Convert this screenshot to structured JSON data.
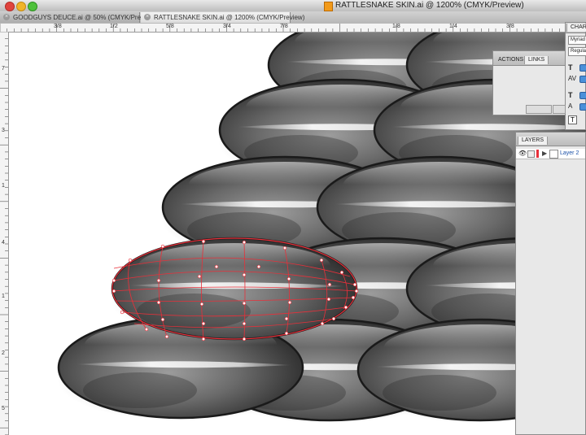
{
  "window": {
    "title": "RATTLESNAKE SKIN.ai @ 1200% (CMYK/Preview)"
  },
  "tabs": [
    {
      "label": "GOODGUYS DEUCE.ai @ 50% (CMYK/Preview)",
      "active": false
    },
    {
      "label": "RATTLESNAKE SKIN.ai @ 1200% (CMYK/Preview)",
      "active": true
    }
  ],
  "ruler_h_labels": [
    "3/8",
    "1/2",
    "5/8",
    "3/4",
    "7/8",
    "1/8",
    "1/4",
    "3/8"
  ],
  "ruler_v_labels": [
    "7",
    "3",
    "1",
    "4",
    "1",
    "2",
    "5"
  ],
  "panels": {
    "character": {
      "title": "CHARA",
      "font": "Myriad",
      "style": "Regula"
    },
    "actions_links": {
      "tabs": [
        "ACTIONS",
        "LINKS"
      ],
      "active": "LINKS"
    },
    "layers": {
      "title": "LAYERS",
      "layer_name": "Layer 2"
    }
  },
  "colors": {
    "accent": "#e8303a",
    "selection": "#3875d7"
  }
}
